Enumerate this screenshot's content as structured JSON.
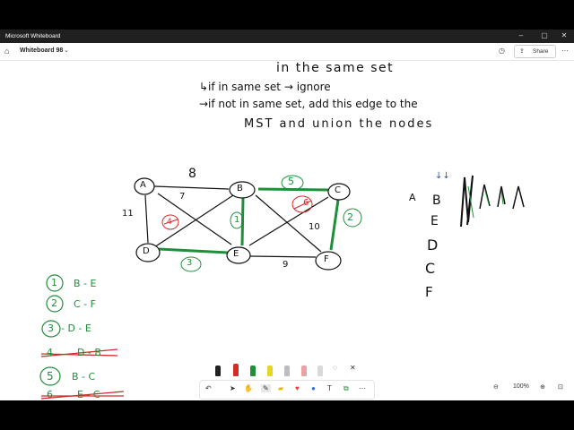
{
  "window": {
    "title": "Microsoft Whiteboard",
    "minimize": "–",
    "maximize": "▢",
    "close": "✕"
  },
  "appbar": {
    "board_name": "Whiteboard 98",
    "share_label": "Share"
  },
  "notes": {
    "line1": "in the same set",
    "line2": "↳if in same set → ignore",
    "line3": "→if not in same set, add this edge to the",
    "line4": "MST and union the nodes"
  },
  "graph": {
    "nodes": [
      "A",
      "B",
      "C",
      "D",
      "E",
      "F"
    ],
    "weights": [
      "8",
      "7",
      "11",
      "5",
      "1",
      "6",
      "3",
      "10",
      "2",
      "9",
      "4"
    ]
  },
  "parent_list": {
    "labels": [
      "A",
      "B",
      "E",
      "D",
      "C",
      "F"
    ],
    "arrows": "↓↓"
  },
  "mst_steps": [
    {
      "num": "1",
      "edge": "B - E"
    },
    {
      "num": "2",
      "edge": "C - F"
    },
    {
      "num": "3",
      "edge": "- D - E"
    },
    {
      "num": "4",
      "edge": "D - B"
    },
    {
      "num": "5",
      "edge": "B - C"
    },
    {
      "num": "6",
      "edge": "E - C"
    }
  ],
  "zoom": {
    "level": "100%"
  },
  "colors": {
    "ink": "#111111",
    "green": "#1f8f3a",
    "red": "#d42a2a",
    "accent": "#2b6fd6"
  }
}
